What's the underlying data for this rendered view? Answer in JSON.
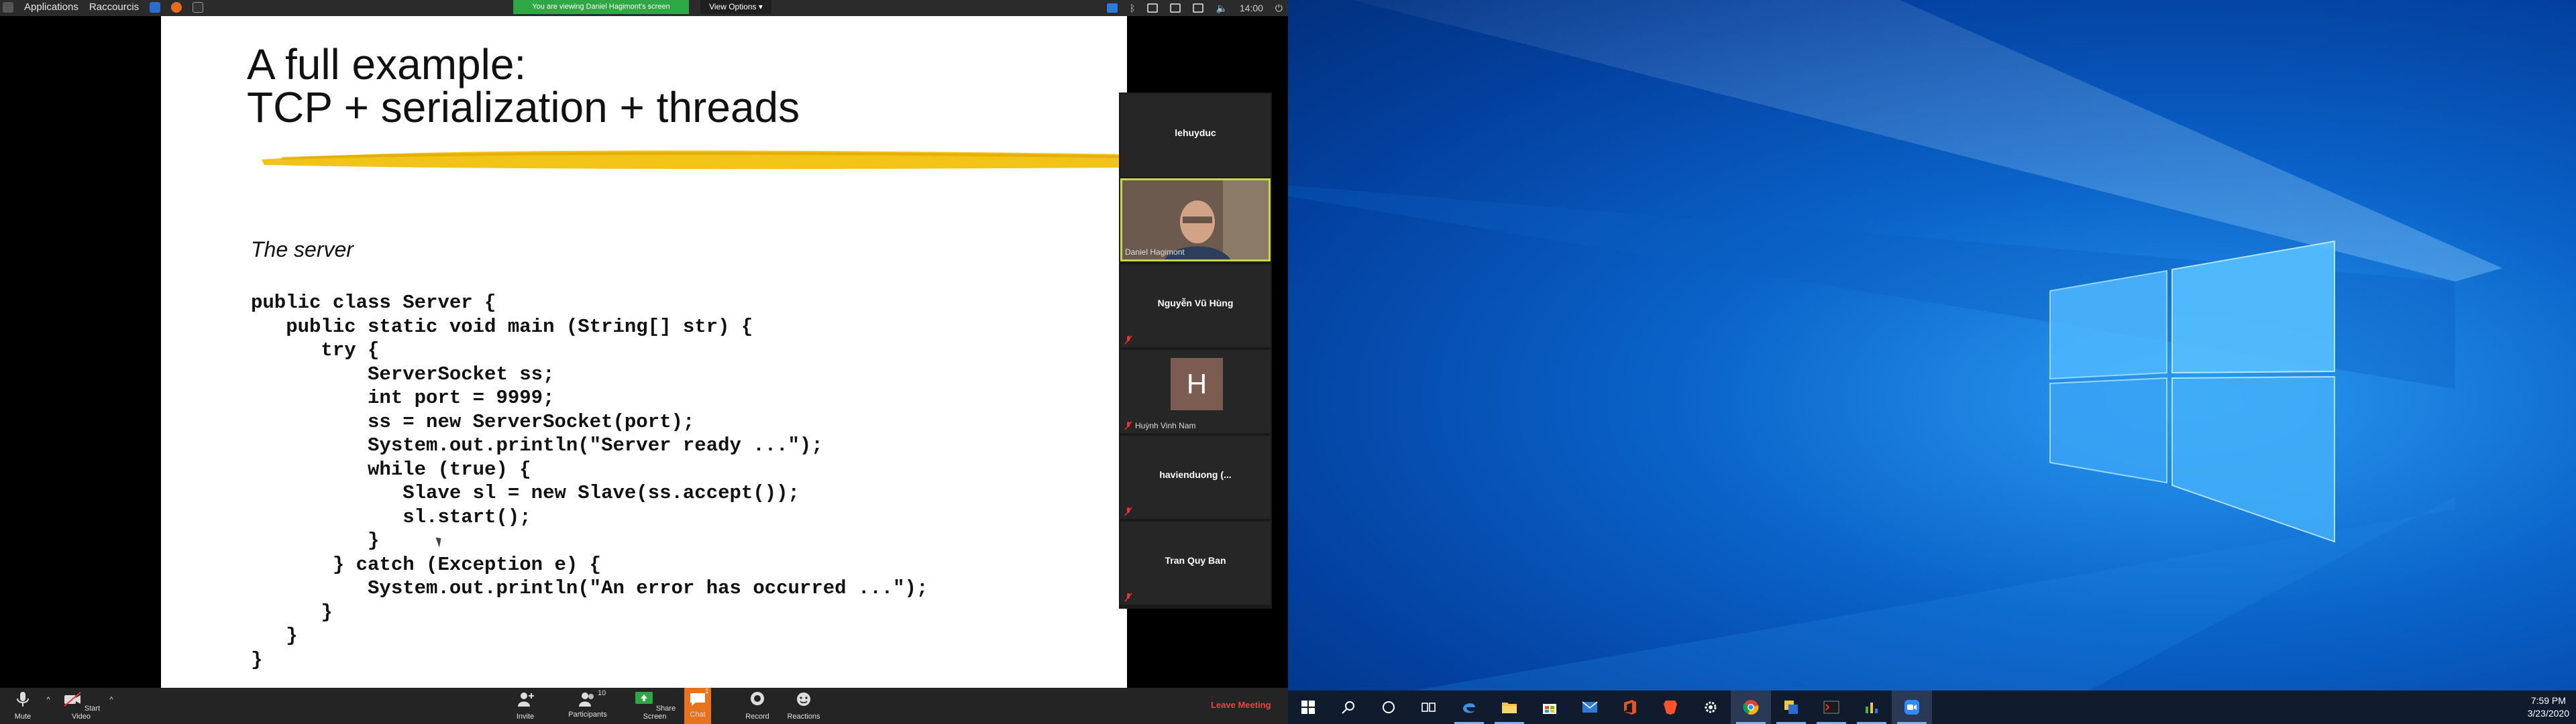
{
  "linux_bar": {
    "applications": "Applications",
    "shortcuts": "Raccourcis",
    "viewing_banner": "You are viewing Daniel Hagimont's screen",
    "view_options": "View Options",
    "time": "14:00"
  },
  "slide": {
    "title_line1": "A full example:",
    "title_line2": "TCP + serialization + threads",
    "subtitle": "The server",
    "code": [
      "public class Server {",
      "   public static void main (String[] str) {",
      "      try {",
      "          ServerSocket ss;",
      "          int port = 9999;",
      "          ss = new ServerSocket(port);",
      "          System.out.println(\"Server ready ...\");",
      "          while (true) {",
      "             Slave sl = new Slave(ss.accept());",
      "             sl.start();",
      "          }",
      "       } catch (Exception e) {",
      "          System.out.println(\"An error has occurred ...\");",
      "      }",
      "   }",
      "}"
    ],
    "highlight_color": "#f2c418"
  },
  "participants": [
    {
      "name": "lehuydcuc_label",
      "label": "lehuyduc",
      "muted": false
    },
    {
      "name": "daniel",
      "label": "Daniel Hagimont",
      "video": true
    },
    {
      "name": "nguyen",
      "label": "Nguyễn Vũ Hùng",
      "muted": true
    },
    {
      "name": "huynh",
      "label": "Huỳnh Vinh Nam",
      "avatar_letter": "H",
      "muted": true
    },
    {
      "name": "havien",
      "label": "havienduong  (...",
      "muted": true
    },
    {
      "name": "tran",
      "label": "Tran Quy Ban",
      "muted": true
    }
  ],
  "zoom_toolbar": {
    "mute": "Mute",
    "start_video": "Start Video",
    "invite": "Invite",
    "participants": "Participants",
    "participants_count": "10",
    "share_screen": "Share Screen",
    "chat": "Chat",
    "chat_badge": "1",
    "record": "Record",
    "reactions": "Reactions",
    "leave": "Leave Meeting"
  },
  "taskbar": {
    "time": "7:59 PM",
    "date": "3/23/2020",
    "icons": [
      "windows-start-icon",
      "search-icon",
      "cortana-icon",
      "task-view-icon",
      "edge-icon",
      "file-explorer-icon",
      "store-icon",
      "mail-icon",
      "office-icon",
      "brave-icon",
      "settings-icon",
      "chrome-icon",
      "app-icon",
      "terminal-icon",
      "chart-app-icon",
      "zoom-icon"
    ]
  },
  "colors": {
    "zoom_green": "#2ea844",
    "chat_orange": "#e8731e",
    "leave_red": "#e44444",
    "desktop_blue": "#0a63c9"
  }
}
